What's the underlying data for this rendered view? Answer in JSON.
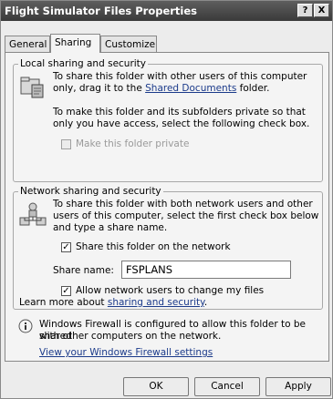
{
  "window": {
    "title": "Flight Simulator Files Properties",
    "help_glyph": "?",
    "close_glyph": "X"
  },
  "tabs": [
    {
      "label": "General",
      "active": false
    },
    {
      "label": "Sharing",
      "active": true
    },
    {
      "label": "Customize",
      "active": false
    }
  ],
  "local": {
    "title": "Local sharing and security",
    "text1_line1": "To share this folder with other users of this computer",
    "text1_prefix": "only, drag it to the ",
    "text1_link": "Shared Documents",
    "text1_suffix": " folder.",
    "text2_line1": "To make this folder and its subfolders private so that",
    "text2_line2": "only you have access, select the following check box.",
    "private_label": "Make this folder private",
    "private_checked": false,
    "icon": "folder-share-icon"
  },
  "network": {
    "title": "Network sharing and security",
    "text_line1": "To share this folder with both network users and other",
    "text_line2": "users of this computer, select the first check box below",
    "text_line3": "and type a share name.",
    "share_label": "Share this folder on the network",
    "share_checked": true,
    "share_name_label": "Share name:",
    "share_name_value": "FSPLANS",
    "allow_label": "Allow network users to change my files",
    "allow_checked": true,
    "learn_prefix": "Learn more about ",
    "learn_link": "sharing and security",
    "learn_suffix": ".",
    "icon": "network-share-icon"
  },
  "firewall": {
    "text_line1": "Windows Firewall is configured to allow this folder to be shared",
    "text_line2": "with other computers on the network.",
    "link": "View your Windows Firewall settings",
    "icon": "info-icon"
  },
  "buttons": {
    "ok": "OK",
    "cancel": "Cancel",
    "apply": "Apply"
  },
  "check_glyph": "✓"
}
